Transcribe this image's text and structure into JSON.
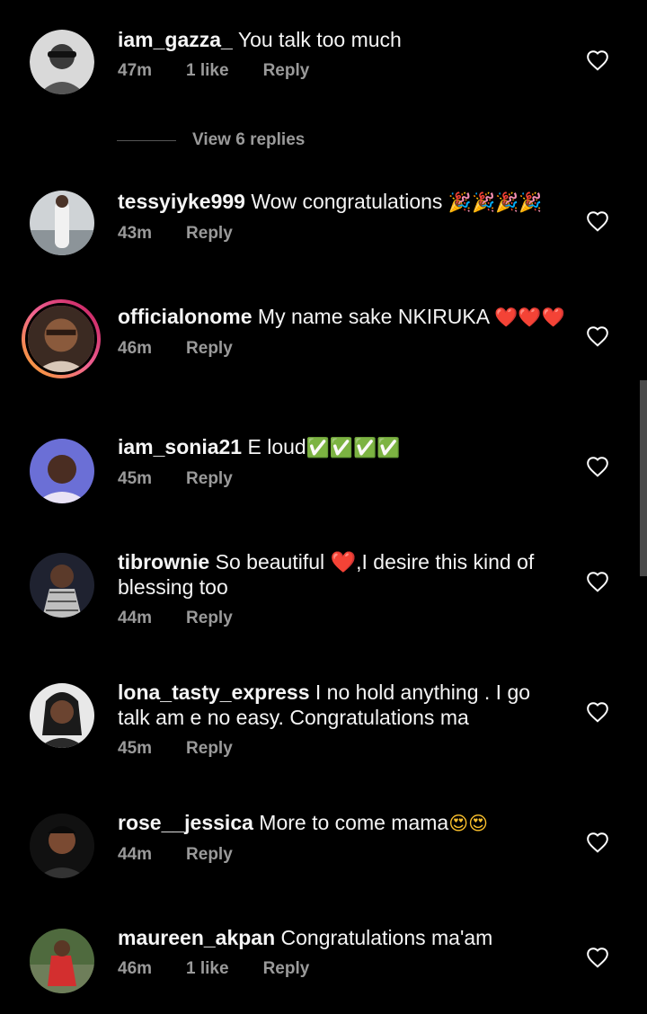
{
  "view_replies": "View 6 replies",
  "comments": [
    {
      "username": "iam_gazza_",
      "text": "You talk too much",
      "emoji": "",
      "time": "47m",
      "likes": "1 like",
      "reply": "Reply"
    },
    {
      "username": "tessyiyke999",
      "text": "Wow congratulations ",
      "emoji": "🎉🎉🎉🎉",
      "time": "43m",
      "likes": "",
      "reply": "Reply"
    },
    {
      "username": "officialonome",
      "text": "My name sake NKIRUKA ",
      "emoji": "❤️❤️❤️",
      "time": "46m",
      "likes": "",
      "reply": "Reply"
    },
    {
      "username": "iam_sonia21",
      "text": "E loud",
      "emoji": "✅✅✅✅",
      "time": "45m",
      "likes": "",
      "reply": "Reply"
    },
    {
      "username": "tibrownie",
      "text": "So beautiful ❤️,I desire this kind of blessing too",
      "emoji": "",
      "time": "44m",
      "likes": "",
      "reply": "Reply"
    },
    {
      "username": "lona_tasty_express",
      "text": "I no hold anything . I go talk am e no easy. Congratulations ma",
      "emoji": "",
      "time": "45m",
      "likes": "",
      "reply": "Reply"
    },
    {
      "username": "rose__jessica",
      "text": "More to come mama",
      "emoji": "😍😍",
      "time": "44m",
      "likes": "",
      "reply": "Reply"
    },
    {
      "username": "maureen_akpan",
      "text": "Congratulations ma'am",
      "emoji": "",
      "time": "46m",
      "likes": "1 like",
      "reply": "Reply"
    }
  ],
  "colors": {
    "background": "#000000",
    "text": "#f5f5f5",
    "meta": "#9a9a9a"
  },
  "icons": {
    "like": "heart-outline-icon"
  }
}
